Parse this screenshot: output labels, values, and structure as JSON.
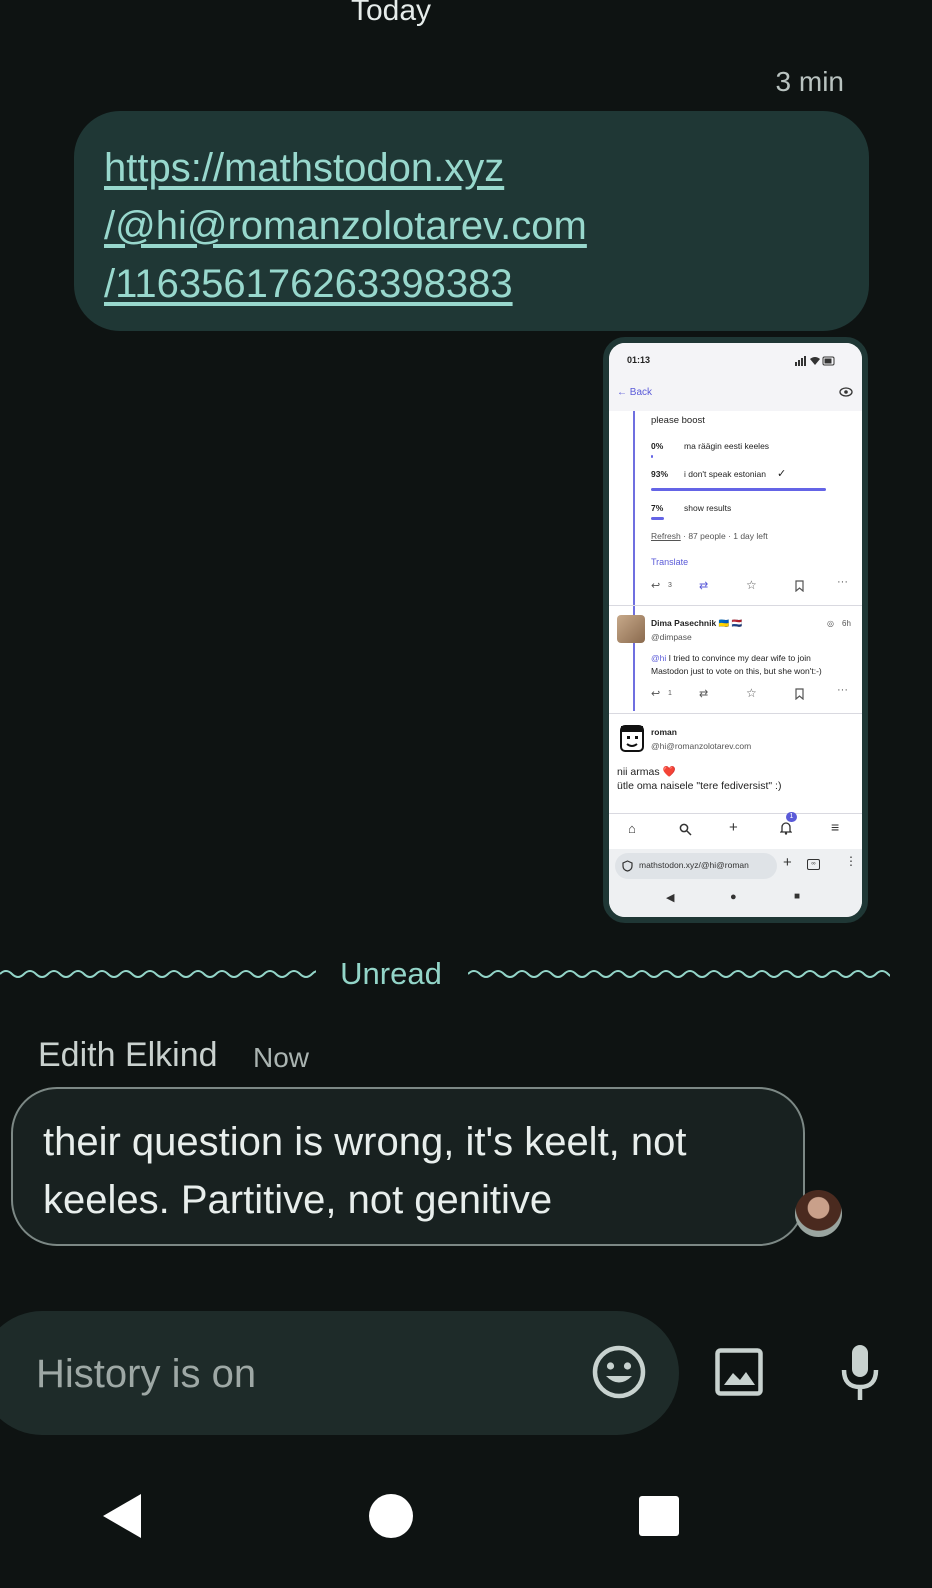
{
  "conversation": {
    "date_header": "Today",
    "outgoing": {
      "time": "3 min",
      "link_lines": [
        "https://mathstodon.xyz",
        "/@hi@romanzolotarev.com",
        "/116356176263398383"
      ]
    },
    "attachment": {
      "status_time": "01:13",
      "back_label": "Back",
      "poll": {
        "question": "please boost",
        "options": [
          {
            "percent": "0%",
            "label": "ma räägin eesti keeles",
            "value": 0
          },
          {
            "percent": "93%",
            "label": "i don't speak estonian",
            "value": 93,
            "selected": true
          },
          {
            "percent": "7%",
            "label": "show results",
            "value": 7
          }
        ],
        "refresh_label": "Refresh",
        "meta": "· 87 people · 1 day left",
        "translate_label": "Translate",
        "reply_count": "3"
      },
      "reply": {
        "name": "Dima Pasechnik 🇺🇦 🇳🇱",
        "handle": "@dimpase",
        "time": "6h",
        "mention": "@hi",
        "text_line1": " I tried to convince my dear wife to join",
        "text_line2": "Mastodon just to vote on this, but she won't:-)",
        "reply_count": "1"
      },
      "author": {
        "name": "roman",
        "handle": "@hi@romanzolotarev.com",
        "text_line1": "nii armas ❤️",
        "text_line2": "ütle oma naisele \"tere fediversist\" :)"
      },
      "notification_badge": "1",
      "url_text": "mathstodon.xyz/@hi@roman"
    },
    "unread_label": "Unread",
    "incoming": {
      "sender": "Edith Elkind",
      "time": "Now",
      "lines": [
        "their question is wrong, it's keelt, not",
        "keeles. Partitive, not genitive"
      ]
    }
  },
  "composer": {
    "placeholder": "History is on",
    "icons": [
      "emoji-icon",
      "image-icon",
      "microphone-icon"
    ]
  },
  "colors": {
    "background": "#0e1312",
    "outgoing_bubble": "#1f3735",
    "link": "#98d8cd",
    "accent": "#93d5c8",
    "poll_accent": "#6464e6"
  }
}
